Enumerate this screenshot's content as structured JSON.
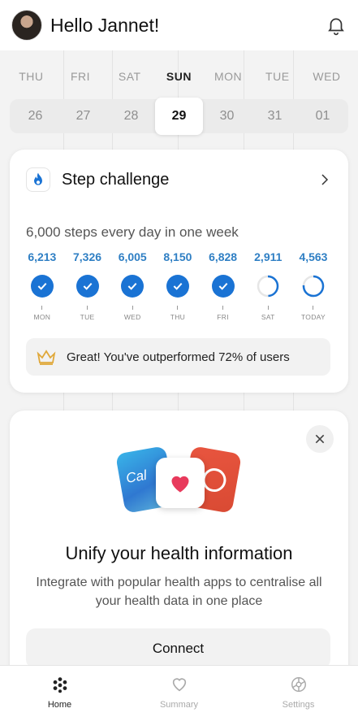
{
  "header": {
    "greeting": "Hello Jannet!",
    "avatar_icon": "user-avatar",
    "notification_icon": "bell-icon"
  },
  "calendar": {
    "days": [
      "THU",
      "FRI",
      "SAT",
      "SUN",
      "MON",
      "TUE",
      "WED"
    ],
    "dates": [
      "26",
      "27",
      "28",
      "29",
      "30",
      "31",
      "01"
    ],
    "selected_day": "SUN",
    "selected_date": "29"
  },
  "step_challenge": {
    "title": "Step challenge",
    "goal": "6,000 steps every day in one week",
    "days": [
      {
        "value": "6,213",
        "label": "MON",
        "completed": true
      },
      {
        "value": "7,326",
        "label": "TUE",
        "completed": true
      },
      {
        "value": "6,005",
        "label": "WED",
        "completed": true
      },
      {
        "value": "8,150",
        "label": "THU",
        "completed": true
      },
      {
        "value": "6,828",
        "label": "FRI",
        "completed": true
      },
      {
        "value": "2,911",
        "label": "SAT",
        "completed": false,
        "progress": 0.49
      },
      {
        "value": "4,563",
        "label": "TODAY",
        "completed": false,
        "progress": 0.76
      }
    ],
    "achievement": "Great! You've outperformed 72% of users",
    "accent_color": "#1a73d4"
  },
  "unify": {
    "app_label": "Cal",
    "title": "Unify your health information",
    "description": "Integrate with popular health apps to centralise all your health data in one place",
    "connect_label": "Connect"
  },
  "nav": {
    "items": [
      {
        "label": "Home",
        "icon": "home-dots-icon",
        "active": true
      },
      {
        "label": "Summary",
        "icon": "heart-icon",
        "active": false
      },
      {
        "label": "Settings",
        "icon": "gear-icon",
        "active": false
      }
    ]
  }
}
